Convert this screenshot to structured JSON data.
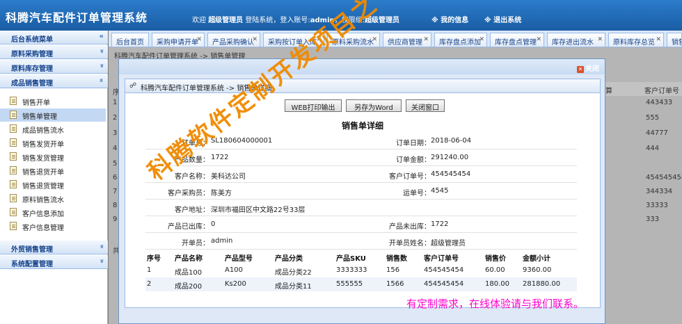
{
  "header": {
    "title": "科腾汽车配件订单管理系统",
    "welcome_prefix": "欢迎",
    "user_role": "超级管理员",
    "login_text": "登陆系统，登入账号:",
    "account": "admin",
    "perm_text": "，权限组:",
    "perm_group": "超级管理员",
    "my_info": "※ 我的信息",
    "logout": "※ 退出系统"
  },
  "sidebar": {
    "sections": [
      {
        "label": "后台系统菜单",
        "chevron": "«"
      },
      {
        "label": "原料采购管理",
        "chevron": "»"
      },
      {
        "label": "原料库存管理",
        "chevron": "»"
      },
      {
        "label": "成品销售管理",
        "chevron": "»"
      },
      {
        "label": "外贸销售管理",
        "chevron": "»"
      },
      {
        "label": "系统配置管理",
        "chevron": "»"
      }
    ],
    "items": [
      {
        "label": "销售开单"
      },
      {
        "label": "销售单管理"
      },
      {
        "label": "成品销售流水"
      },
      {
        "label": "销售发货开单"
      },
      {
        "label": "销售发货管理"
      },
      {
        "label": "销售退货开单"
      },
      {
        "label": "销售退货管理"
      },
      {
        "label": "原料销售流水"
      },
      {
        "label": "客户信息添加"
      },
      {
        "label": "客户信息管理"
      }
    ]
  },
  "tabs": [
    {
      "label": "后台首页"
    },
    {
      "label": "采购申请开单"
    },
    {
      "label": "产品采购确认"
    },
    {
      "label": "采购按订单入库"
    },
    {
      "label": "原料采购流水"
    },
    {
      "label": "供应商管理"
    },
    {
      "label": "库存盘点添加"
    },
    {
      "label": "库存盘点管理"
    },
    {
      "label": "库存进出流水"
    },
    {
      "label": "原料库存总览"
    },
    {
      "label": "销售"
    }
  ],
  "background": {
    "crumb": "科腾汽车配件订单管理系统 -> 销售单管理",
    "col_left": "序",
    "col_right1": "算",
    "col_right2": "客户订单号",
    "row_nums": [
      "1",
      "2",
      "3",
      "4",
      "5",
      "6",
      "7",
      "8",
      "9"
    ],
    "right_values": [
      "443433",
      "555",
      "44777",
      "444",
      "",
      "454545454",
      "344334",
      "33333",
      "333"
    ],
    "footer_left": "共"
  },
  "modal": {
    "close_label": "关闭",
    "crumb": "科腾汽车配件订单管理系统 -> 销售单详细",
    "buttons": {
      "print": "WEB打印输出",
      "word": "另存为Word",
      "close": "关闭窗口"
    },
    "doc_title": "销售单详细",
    "fields": {
      "order_no_label": "订单号：",
      "order_no": "SL180604000001",
      "order_date_label": "订单日期：",
      "order_date": "2018-06-04",
      "qty_label": "产品数量：",
      "qty": "1722",
      "amount_label": "订单金额：",
      "amount": "291240.00",
      "customer_label": "客户名称：",
      "customer": "美科达公司",
      "cust_order_label": "客户订单号：",
      "cust_order": "454545454",
      "buyer_label": "客户采购员：",
      "buyer": "陈美方",
      "carrier_label": "运单号：",
      "carrier": "4545",
      "address_label": "客户地址：",
      "address": "深圳市福田区中文路22号33层",
      "shipped_label": "产品已出库：",
      "shipped": "0",
      "unshipped_label": "产品未出库：",
      "unshipped": "1722",
      "opener_label": "开单员：",
      "opener": "admin",
      "opener_name_label": "开单员姓名：",
      "opener_name": "超级管理员"
    },
    "table": {
      "headers": [
        "序号",
        "产品名称",
        "产品型号",
        "产品分类",
        "产品SKU",
        "销售数",
        "客户订单号",
        "销售价",
        "金额小计"
      ],
      "rows": [
        [
          "1",
          "成品100",
          "A100",
          "成品分类22",
          "3333333",
          "156",
          "454545454",
          "60.00",
          "9360.00"
        ],
        [
          "2",
          "成品200",
          "Ks200",
          "成品分类11",
          "555555",
          "1566",
          "454545454",
          "180.00",
          "281880.00"
        ]
      ]
    }
  },
  "watermark": "科腾软件定制开发项目之一",
  "promo": "有定制需求，在线体验请与我们联系。"
}
